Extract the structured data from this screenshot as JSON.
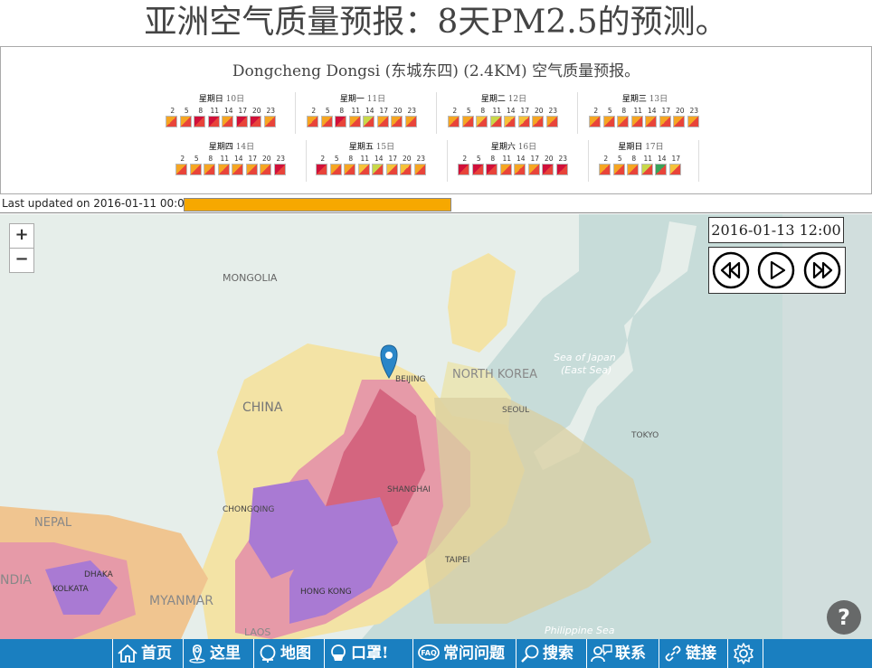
{
  "title": "亚洲空气质量预报：8天PM2.5的预测。",
  "station": "Dongcheng Dongsi (东城东四) (2.4KM) 空气质量预报。",
  "days": [
    {
      "name": "星期日",
      "num": "10日",
      "hours": [
        "2",
        "5",
        "8",
        "11",
        "14",
        "17",
        "20",
        "23"
      ],
      "colors": [
        "#f5a623",
        "#f5a623",
        "#d0103a",
        "#d0103a",
        "#f5a623",
        "#d0103a",
        "#d0103a",
        "#f5a623"
      ]
    },
    {
      "name": "星期一",
      "num": "11日",
      "hours": [
        "2",
        "5",
        "8",
        "11",
        "14",
        "17",
        "20",
        "23"
      ],
      "colors": [
        "#f5a623",
        "#f5a623",
        "#d0103a",
        "#f5a623",
        "#c8d84a",
        "#f5a623",
        "#f5a623",
        "#f5a623"
      ]
    },
    {
      "name": "星期二",
      "num": "12日",
      "hours": [
        "2",
        "5",
        "8",
        "11",
        "14",
        "17",
        "20",
        "23"
      ],
      "colors": [
        "#f5a623",
        "#f5a623",
        "#f5c23a",
        "#c8d84a",
        "#f5c23a",
        "#f5c23a",
        "#f5a623",
        "#f5a623"
      ]
    },
    {
      "name": "星期三",
      "num": "13日",
      "hours": [
        "2",
        "5",
        "8",
        "11",
        "14",
        "17",
        "20",
        "23"
      ],
      "colors": [
        "#f5a623",
        "#f5a623",
        "#f5a623",
        "#f5a623",
        "#f5a623",
        "#f5a623",
        "#f5a623",
        "#f5a623"
      ]
    },
    {
      "name": "星期四",
      "num": "14日",
      "hours": [
        "2",
        "5",
        "8",
        "11",
        "14",
        "17",
        "20",
        "23"
      ],
      "colors": [
        "#f5a623",
        "#f5a623",
        "#f5a623",
        "#f5a623",
        "#f5a623",
        "#f5a623",
        "#f5a623",
        "#d0103a"
      ]
    },
    {
      "name": "星期五",
      "num": "15日",
      "hours": [
        "2",
        "5",
        "8",
        "11",
        "14",
        "17",
        "20",
        "23"
      ],
      "colors": [
        "#d0103a",
        "#f5a623",
        "#f5a623",
        "#f5c23a",
        "#c8d84a",
        "#f5c23a",
        "#f5c23a",
        "#f5a623"
      ]
    },
    {
      "name": "星期六",
      "num": "16日",
      "hours": [
        "2",
        "5",
        "8",
        "11",
        "14",
        "17",
        "20",
        "23"
      ],
      "colors": [
        "#d0103a",
        "#d0103a",
        "#d0103a",
        "#f5a623",
        "#f5a623",
        "#f5a623",
        "#d0103a",
        "#d0103a"
      ]
    },
    {
      "name": "星期日",
      "num": "17日",
      "hours": [
        "2",
        "5",
        "8",
        "11",
        "14",
        "17"
      ],
      "colors": [
        "#f5a623",
        "#f5a623",
        "#f5a623",
        "#c8d84a",
        "#3aa35a",
        "#f5c23a"
      ]
    }
  ],
  "updated_label": "Last updated on 2016-01-11 00:00:",
  "progress_color": "#f6a800",
  "map": {
    "time": "2016-01-13 12:00",
    "zoom_in": "+",
    "zoom_out": "−",
    "labels": {
      "mongolia": "MONGOLIA",
      "china": "CHINA",
      "beijing": "BEIJING",
      "north_korea": "NORTH KOREA",
      "seoul": "SEOUL",
      "sea_of_japan": "Sea of Japan",
      "east_sea": "(East Sea)",
      "tokyo": "TOKYO",
      "shanghai": "SHANGHAI",
      "chongqing": "CHONGQING",
      "taipei": "TAIPEI",
      "hong_kong": "HONG KONG",
      "nepal": "NEPAL",
      "india": "NDIA",
      "dhaka": "DHAKA",
      "kolkata": "KOLKATA",
      "myanmar": "MYANMAR",
      "laos": "LAOS",
      "philippine_sea": "Philippine Sea"
    },
    "help": "?"
  },
  "nav": [
    {
      "label": "首页",
      "icon": "home-icon"
    },
    {
      "label": "这里",
      "icon": "location-icon"
    },
    {
      "label": "地图",
      "icon": "globe-icon"
    },
    {
      "label": "口罩!",
      "icon": "mask-icon"
    },
    {
      "label": "常问问题",
      "icon": "faq-icon"
    },
    {
      "label": "搜索",
      "icon": "search-icon"
    },
    {
      "label": "联系",
      "icon": "contact-icon"
    },
    {
      "label": "链接",
      "icon": "link-icon"
    },
    {
      "label": "",
      "icon": "gear-icon"
    }
  ]
}
